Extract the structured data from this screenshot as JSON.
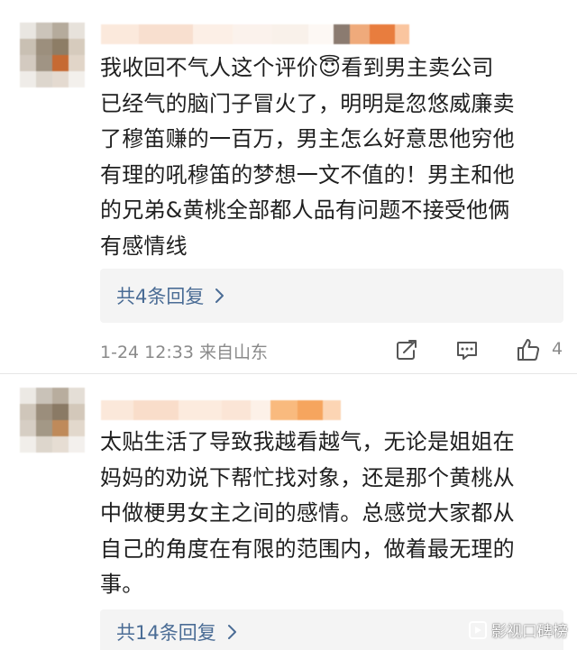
{
  "comments": [
    {
      "lines": [
        "我收回不气人这个评价😇看到男主卖公司",
        "已经气的脑门子冒火了，明明是忽悠威廉卖",
        "了穆笛赚的一百万，男主怎么好意思他穷他",
        "有理的吼穆笛的梦想一文不值的！男主和他",
        "的兄弟&黄桃全部都人品有问题不接受他俩",
        "有感情线"
      ],
      "reply_label": "共4条回复",
      "time": "1-24 12:33",
      "location": "来自山东",
      "like_count": "4",
      "icons": [
        "forward-icon",
        "comment-icon",
        "like-icon"
      ]
    },
    {
      "lines": [
        "太贴生活了导致我越看越气，无论是姐姐在",
        "妈妈的劝说下帮忙找对象，还是那个黄桃从",
        "中做梗男女主之间的感情。总感觉大家都从",
        "自己的角度在有限的范围内，做着最无理的",
        "事。"
      ],
      "reply_label": "共14条回复"
    }
  ],
  "watermark": "影视口碑榜",
  "colors": {
    "reply_link": "#4a6c95",
    "meta_text": "#8a8a8a",
    "reply_background": "#f4f4f4"
  }
}
